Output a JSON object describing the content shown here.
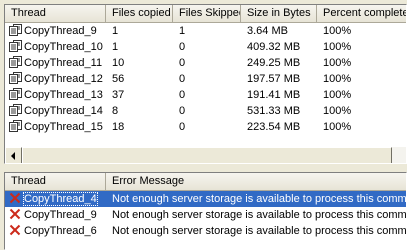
{
  "copy_table": {
    "headers": [
      "Thread",
      "Files copied",
      "Files Skipped",
      "Size in Bytes",
      "Percent complete"
    ],
    "rows": [
      {
        "thread": "CopyThread_9",
        "files_copied": "1",
        "files_skipped": "1",
        "size": "3.64 MB",
        "percent": "100%"
      },
      {
        "thread": "CopyThread_10",
        "files_copied": "1",
        "files_skipped": "0",
        "size": "409.32 MB",
        "percent": "100%"
      },
      {
        "thread": "CopyThread_11",
        "files_copied": "10",
        "files_skipped": "0",
        "size": "249.25 MB",
        "percent": "100%"
      },
      {
        "thread": "CopyThread_12",
        "files_copied": "56",
        "files_skipped": "0",
        "size": "197.57 MB",
        "percent": "100%"
      },
      {
        "thread": "CopyThread_13",
        "files_copied": "37",
        "files_skipped": "0",
        "size": "191.41 MB",
        "percent": "100%"
      },
      {
        "thread": "CopyThread_14",
        "files_copied": "8",
        "files_skipped": "0",
        "size": "531.33 MB",
        "percent": "100%"
      },
      {
        "thread": "CopyThread_15",
        "files_copied": "18",
        "files_skipped": "0",
        "size": "223.54 MB",
        "percent": "100%"
      }
    ],
    "row_icon": "copy-document-icon"
  },
  "error_table": {
    "headers": [
      "Thread",
      "Error Message"
    ],
    "rows": [
      {
        "thread": "CopyThread_4",
        "message": "Not enough server storage is available to process this command.",
        "selected": true
      },
      {
        "thread": "CopyThread_9",
        "message": "Not enough server storage is available to process this command.",
        "selected": false
      },
      {
        "thread": "CopyThread_6",
        "message": "Not enough server storage is available to process this command.",
        "selected": false
      }
    ],
    "row_icon": "error-x-icon"
  },
  "colors": {
    "selection": "#316ac5",
    "error_x": "#cc2a1b",
    "window_bg": "#ece9d8"
  }
}
